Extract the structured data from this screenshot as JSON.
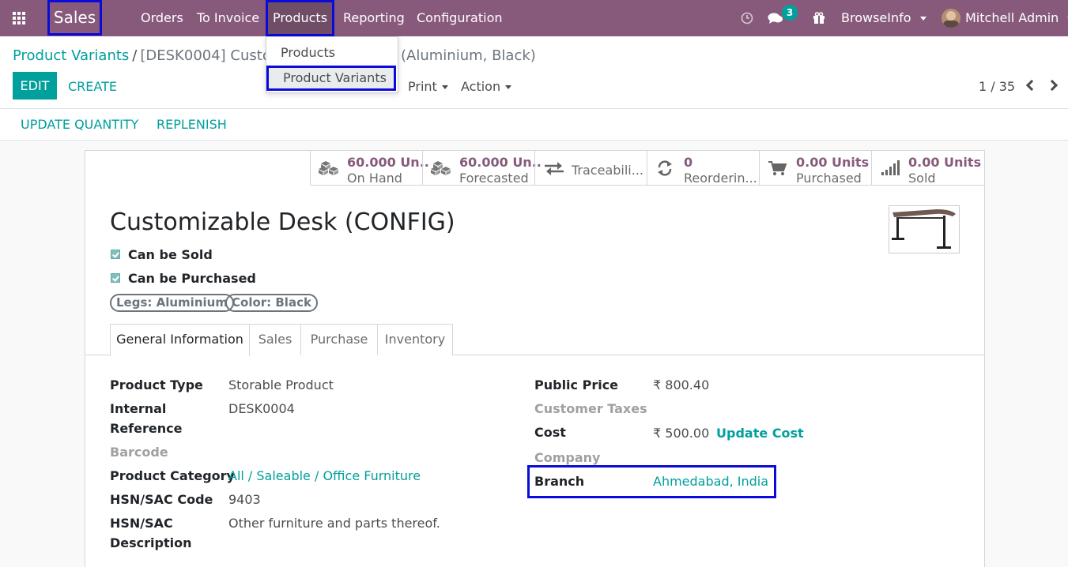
{
  "navbar": {
    "app_name": "Sales",
    "menu": [
      "Orders",
      "To Invoice",
      "Products",
      "Reporting",
      "Configuration"
    ],
    "chat_count": "3",
    "company": "BrowseInfo",
    "user": "Mitchell Admin"
  },
  "dropdown": {
    "items": [
      "Products",
      "Product Variants"
    ]
  },
  "breadcrumb": {
    "parent": "Product Variants",
    "current_start": "[DESK0004] Customi",
    "current_end": "(Aluminium, Black)"
  },
  "actions": {
    "edit": "EDIT",
    "create": "CREATE",
    "print": "Print",
    "action": "Action",
    "pager": "1 / 35",
    "update_quantity": "UPDATE QUANTITY",
    "replenish": "REPLENISH"
  },
  "smart_buttons": [
    {
      "value": "60.000 Un..",
      "label": "On Hand",
      "icon": "cubes-icon"
    },
    {
      "value": "60.000 Un..",
      "label": "Forecasted",
      "icon": "cubes-icon"
    },
    {
      "value": "",
      "label": "Traceabili...",
      "icon": "arrows-icon"
    },
    {
      "value": "0",
      "label": "Reorderin...",
      "icon": "refresh-icon"
    },
    {
      "value": "0.00 Units",
      "label": "Purchased",
      "icon": "cart-icon"
    },
    {
      "value": "0.00 Units",
      "label": "Sold",
      "icon": "signal-icon"
    }
  ],
  "product": {
    "name": "Customizable Desk (CONFIG)",
    "can_be_sold": "Can be Sold",
    "can_be_purchased": "Can be Purchased",
    "tags": [
      "Legs: Aluminium",
      "Color: Black"
    ]
  },
  "tabs": [
    "General Information",
    "Sales",
    "Purchase",
    "Inventory"
  ],
  "left_fields": {
    "product_type_label": "Product Type",
    "product_type": "Storable Product",
    "internal_ref_label1": "Internal",
    "internal_ref_label2": "Reference",
    "internal_ref": "DESK0004",
    "barcode_label": "Barcode",
    "category_label": "Product Category",
    "category": "All / Saleable / Office Furniture",
    "hsn_label": "HSN/SAC Code",
    "hsn": "9403",
    "hsn_desc_label1": "HSN/SAC",
    "hsn_desc_label2": "Description",
    "hsn_desc": "Other furniture and parts thereof."
  },
  "right_fields": {
    "public_price_label": "Public Price",
    "public_price": "₹ 800.40",
    "customer_taxes_label": "Customer Taxes",
    "cost_label": "Cost",
    "cost": "₹ 500.00",
    "update_cost": "Update Cost",
    "company_label": "Company",
    "branch_label": "Branch",
    "branch": "Ahmedabad, India"
  },
  "colors": {
    "navbar": "#875a7b",
    "accent": "#00a09d",
    "highlight": "#0b0bd9"
  }
}
